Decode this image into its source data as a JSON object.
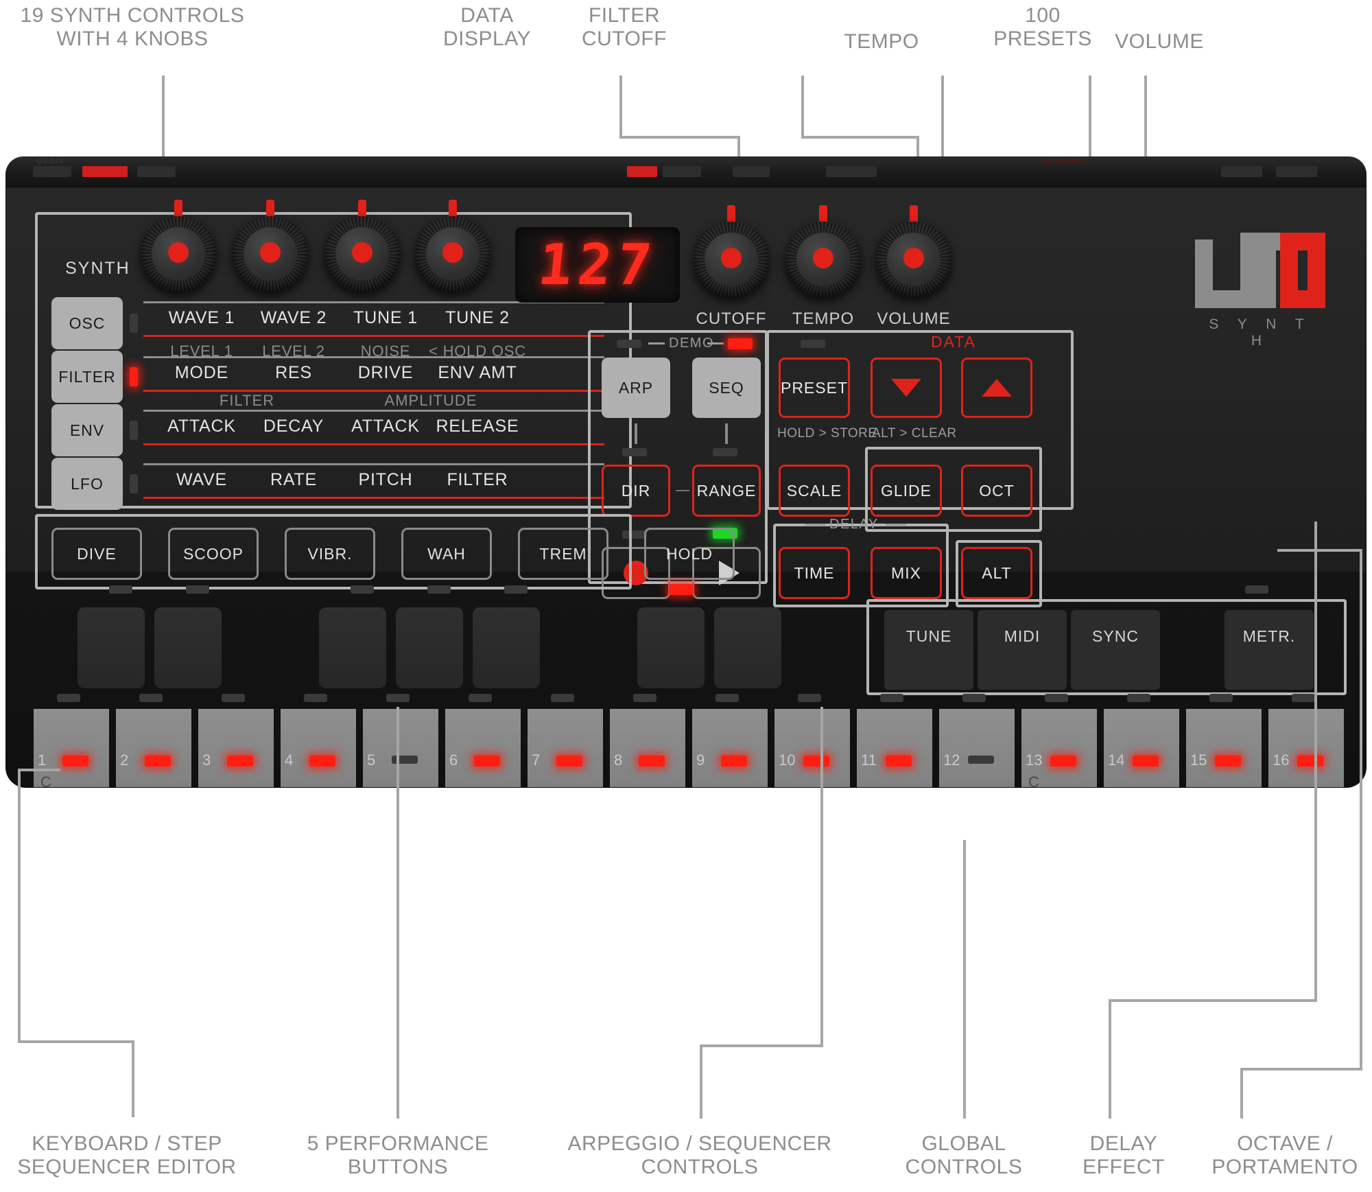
{
  "callouts": {
    "top": [
      {
        "id": "synth-controls",
        "text": "19 SYNTH CONTROLS\nWITH 4 KNOBS"
      },
      {
        "id": "data-display",
        "text": "DATA\nDISPLAY"
      },
      {
        "id": "filter-cutoff",
        "text": "FILTER\nCUTOFF"
      },
      {
        "id": "tempo",
        "text": "TEMPO"
      },
      {
        "id": "presets",
        "text": "100\nPRESETS"
      },
      {
        "id": "volume",
        "text": "VOLUME"
      }
    ],
    "bottom": [
      {
        "id": "keyboard-step-sequencer",
        "text": "KEYBOARD / STEP\nSEQUENCER EDITOR"
      },
      {
        "id": "performance-buttons",
        "text": "5 PERFORMANCE\nBUTTONS"
      },
      {
        "id": "arp-seq-controls",
        "text": "ARPEGGIO / SEQUENCER\nCONTROLS"
      },
      {
        "id": "global-controls",
        "text": "GLOBAL\nCONTROLS"
      },
      {
        "id": "delay-effect",
        "text": "DELAY\nEFFECT"
      },
      {
        "id": "octave-portamento",
        "text": "OCTAVE /\nPORTAMENTO"
      }
    ]
  },
  "device": {
    "brand": {
      "name": "UNO",
      "sub": "S Y N T H"
    },
    "display": {
      "value": "127"
    },
    "knobs": [
      {
        "name": "knob-1",
        "label": ""
      },
      {
        "name": "knob-2",
        "label": ""
      },
      {
        "name": "knob-3",
        "label": ""
      },
      {
        "name": "knob-4",
        "label": ""
      },
      {
        "name": "cutoff",
        "label": "CUTOFF"
      },
      {
        "name": "tempo",
        "label": "TEMPO"
      },
      {
        "name": "volume",
        "label": "VOLUME"
      }
    ],
    "synth_section": {
      "title": "SYNTH",
      "mode_buttons": [
        {
          "label": "OSC",
          "led": "off"
        },
        {
          "label": "FILTER",
          "led": "on"
        },
        {
          "label": "ENV",
          "led": "off"
        },
        {
          "label": "LFO",
          "led": "off"
        }
      ],
      "rows": [
        {
          "id": "osc",
          "cells": [
            "WAVE 1",
            "WAVE 2",
            "TUNE 1",
            "TUNE 2"
          ],
          "sub": [
            "LEVEL 1",
            "LEVEL 2",
            "NOISE",
            "< HOLD OSC"
          ],
          "caps": []
        },
        {
          "id": "filter",
          "cells": [
            "MODE",
            "RES",
            "DRIVE",
            "ENV AMT"
          ],
          "sub": [],
          "caps": []
        },
        {
          "id": "env",
          "cells": [
            "ATTACK",
            "DECAY",
            "ATTACK",
            "RELEASE"
          ],
          "sub": [],
          "caps": [
            "FILTER",
            "AMPLITUDE"
          ]
        },
        {
          "id": "lfo",
          "cells": [
            "WAVE",
            "RATE",
            "PITCH",
            "FILTER"
          ],
          "sub": [],
          "caps": []
        }
      ]
    },
    "performance_buttons": [
      {
        "label": "DIVE"
      },
      {
        "label": "SCOOP"
      },
      {
        "label": "VIBR."
      },
      {
        "label": "WAH"
      },
      {
        "label": "TREM"
      }
    ],
    "hold_button": {
      "label": "HOLD"
    },
    "arp_seq": {
      "demo_label": "DEMO",
      "demo_led_left": "off",
      "demo_led_right": "on",
      "buttons": [
        {
          "label": "ARP",
          "style": "grey"
        },
        {
          "label": "SEQ",
          "style": "grey"
        },
        {
          "label": "DIR",
          "style": "outline-red"
        },
        {
          "label": "RANGE",
          "style": "outline-red"
        }
      ],
      "dash": "—",
      "record_icon": "record-icon",
      "play_icon": "play-icon",
      "record_led": "off",
      "play_led": "on-green"
    },
    "scale_button": {
      "label": "SCALE"
    },
    "preset": {
      "button_label": "PRESET",
      "sub_label": "HOLD > STORE",
      "led": "off"
    },
    "data": {
      "title": "DATA",
      "down_icon": "triangle-down-icon",
      "up_icon": "triangle-up-icon",
      "sub_label": "ALT > CLEAR"
    },
    "glide_oct": [
      {
        "label": "GLIDE"
      },
      {
        "label": "OCT"
      }
    ],
    "delay": {
      "title": "DELAY",
      "buttons": [
        {
          "label": "TIME"
        },
        {
          "label": "MIX"
        }
      ]
    },
    "alt_button": {
      "label": "ALT"
    },
    "global_buttons": [
      {
        "label": "TUNE"
      },
      {
        "label": "MIDI"
      },
      {
        "label": "SYNC"
      },
      {
        "label": "METR."
      }
    ],
    "keyboard": {
      "note_markers": [
        "C",
        "C"
      ],
      "steps": [
        {
          "num": "1",
          "led": "on"
        },
        {
          "num": "2",
          "led": "on"
        },
        {
          "num": "3",
          "led": "on"
        },
        {
          "num": "4",
          "led": "on"
        },
        {
          "num": "5",
          "led": "off"
        },
        {
          "num": "6",
          "led": "on"
        },
        {
          "num": "7",
          "led": "on"
        },
        {
          "num": "8",
          "led": "on"
        },
        {
          "num": "9",
          "led": "on"
        },
        {
          "num": "10",
          "led": "on"
        },
        {
          "num": "11",
          "led": "on"
        },
        {
          "num": "12",
          "led": "off"
        },
        {
          "num": "13",
          "led": "on"
        },
        {
          "num": "14",
          "led": "on"
        },
        {
          "num": "15",
          "led": "on"
        },
        {
          "num": "16",
          "led": "on"
        }
      ]
    }
  },
  "colors": {
    "accent_red": "#e0231a",
    "led_red": "#ff1f12",
    "led_green": "#1fd428",
    "callout_grey": "#8d8d8d",
    "leader_grey": "#a6a6a6"
  }
}
